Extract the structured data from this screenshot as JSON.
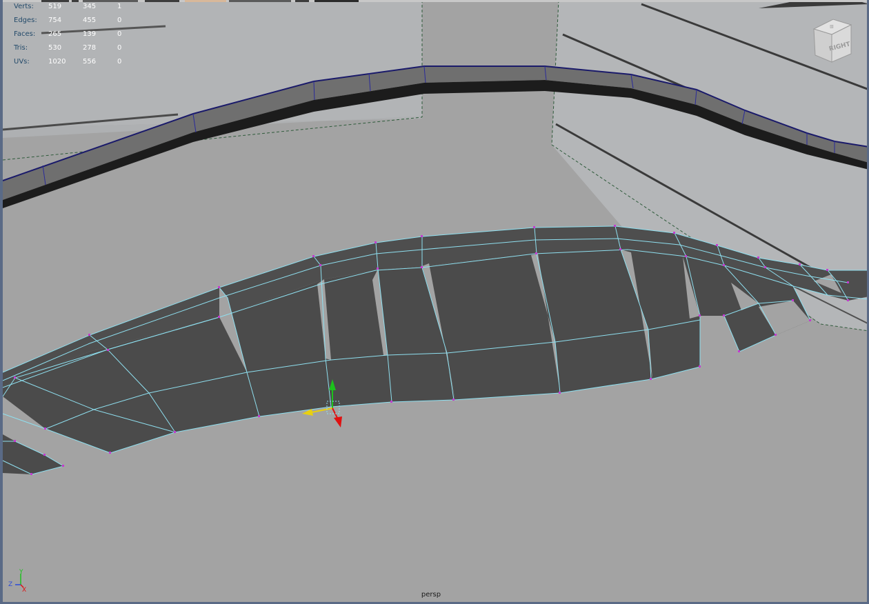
{
  "hud": {
    "rows": [
      {
        "label": "Verts:",
        "c1": "519",
        "c2": "345",
        "c3": "1"
      },
      {
        "label": "Edges:",
        "c1": "754",
        "c2": "455",
        "c3": "0"
      },
      {
        "label": "Faces:",
        "c1": "265",
        "c2": "139",
        "c3": "0"
      },
      {
        "label": "Tris:",
        "c1": "530",
        "c2": "278",
        "c3": "0"
      },
      {
        "label": "UVs:",
        "c1": "1020",
        "c2": "556",
        "c3": "0"
      }
    ]
  },
  "camera_label": "persp",
  "viewcube_face": "RIGHT",
  "axis": {
    "y": "Y",
    "z": "Z",
    "x": "X"
  },
  "colors": {
    "viewport_bg": "#a3a3a3",
    "mesh_face": "#4d4d4d",
    "wireframe": "#8fe0f0",
    "vertex": "#c33bd0",
    "rail_top": "#7a7a7a",
    "rail_side": "#1e1e1e",
    "manip_y": "#1cc21c",
    "manip_x": "#e01010",
    "manip_z": "#e8d010"
  },
  "icons": [
    "view-cube-icon",
    "axis-triad-icon",
    "move-manipulator-icon"
  ]
}
